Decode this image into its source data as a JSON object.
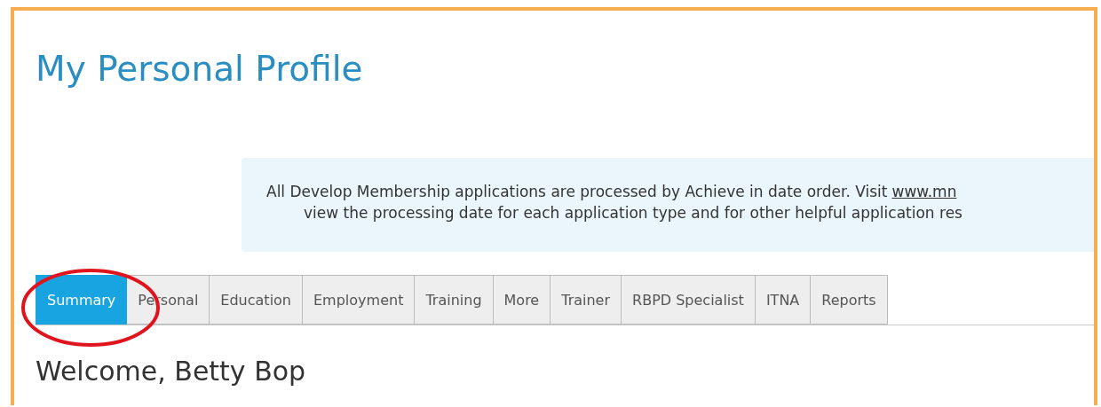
{
  "title": "My Personal Profile",
  "notice": {
    "line_1": "All Develop Membership applications are processed by Achieve in date order. Visit",
    "link": "www.mn",
    "line_2": "view the processing date for each application type and for other helpful application res"
  },
  "tabs": [
    {
      "label": "Summary",
      "selected": true
    },
    {
      "label": "Personal",
      "selected": false
    },
    {
      "label": "Education",
      "selected": false
    },
    {
      "label": "Employment",
      "selected": false
    },
    {
      "label": "Training",
      "selected": false
    },
    {
      "label": "More",
      "selected": false
    },
    {
      "label": "Trainer",
      "selected": false
    },
    {
      "label": "RBPD Specialist",
      "selected": false
    },
    {
      "label": "ITNA",
      "selected": false
    },
    {
      "label": "Reports",
      "selected": false
    }
  ],
  "welcome": "Welcome, Betty Bop"
}
